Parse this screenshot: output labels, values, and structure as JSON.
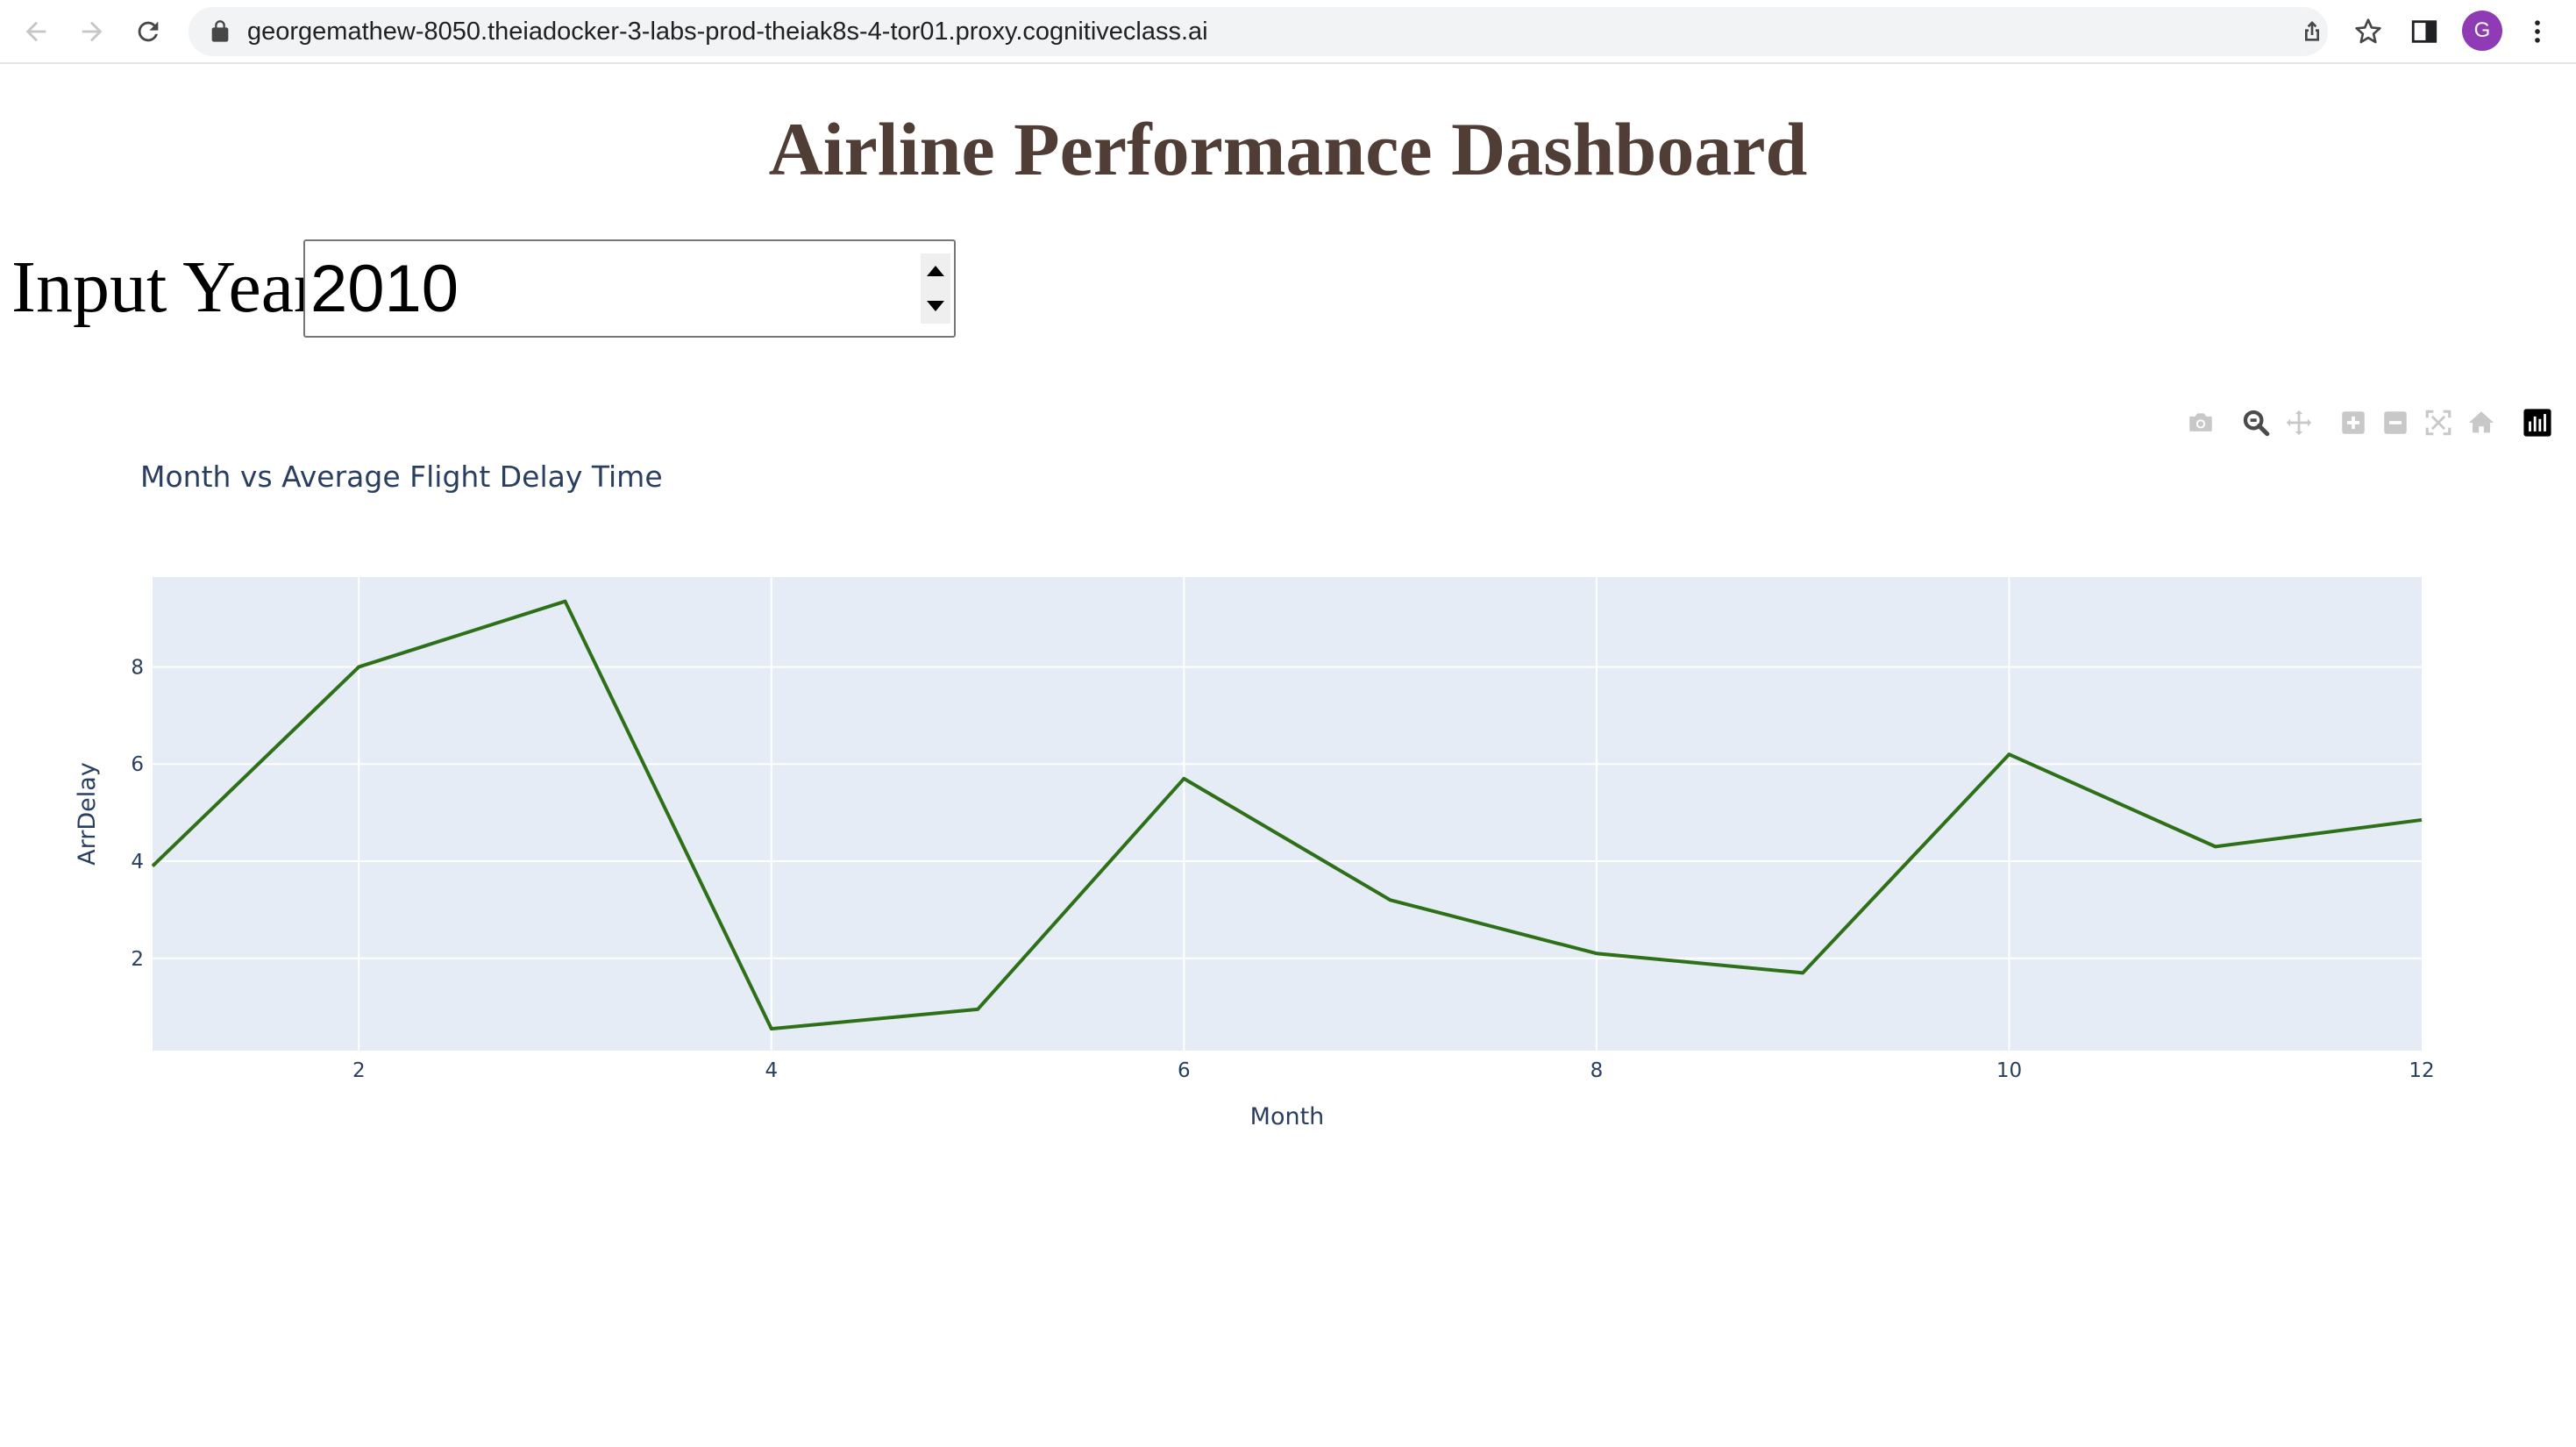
{
  "browser": {
    "url": "georgemathew-8050.theiadocker-3-labs-prod-theiak8s-4-tor01.proxy.cognitiveclass.ai",
    "avatar_initial": "G",
    "avatar_color": "#8e3bb5",
    "icons": [
      "back-icon",
      "forward-icon",
      "reload-icon",
      "lock-icon",
      "share-icon",
      "star-icon",
      "side-panel-icon",
      "more-icon"
    ]
  },
  "page": {
    "title": "Airline Performance Dashboard",
    "title_color": "#503d36"
  },
  "year_input": {
    "label": "Input Year",
    "value": "2010"
  },
  "modebar": {
    "icons": [
      "camera-icon",
      "zoom-icon",
      "pan-icon",
      "zoom-in-icon",
      "zoom-out-icon",
      "autoscale-icon",
      "reset-axes-icon",
      "plotly-logo-icon"
    ]
  },
  "chart_data": {
    "type": "line",
    "title": "Month vs Average Flight Delay Time",
    "xlabel": "Month",
    "ylabel": "ArrDelay",
    "x": [
      1,
      2,
      3,
      4,
      5,
      6,
      7,
      8,
      9,
      10,
      11,
      12
    ],
    "series": [
      {
        "values": [
          3.9,
          8.0,
          9.35,
          0.55,
          0.95,
          5.7,
          3.2,
          2.1,
          1.7,
          6.2,
          4.3,
          4.85
        ],
        "color": "#2e7018"
      }
    ],
    "xlim": [
      1,
      12
    ],
    "ylim": [
      0.1,
      9.85
    ],
    "xticks": [
      2,
      4,
      6,
      8,
      10,
      12
    ],
    "yticks": [
      2,
      4,
      6,
      8
    ],
    "grid": true,
    "plot_bgcolor": "#e5ecf6",
    "legend": "none"
  }
}
